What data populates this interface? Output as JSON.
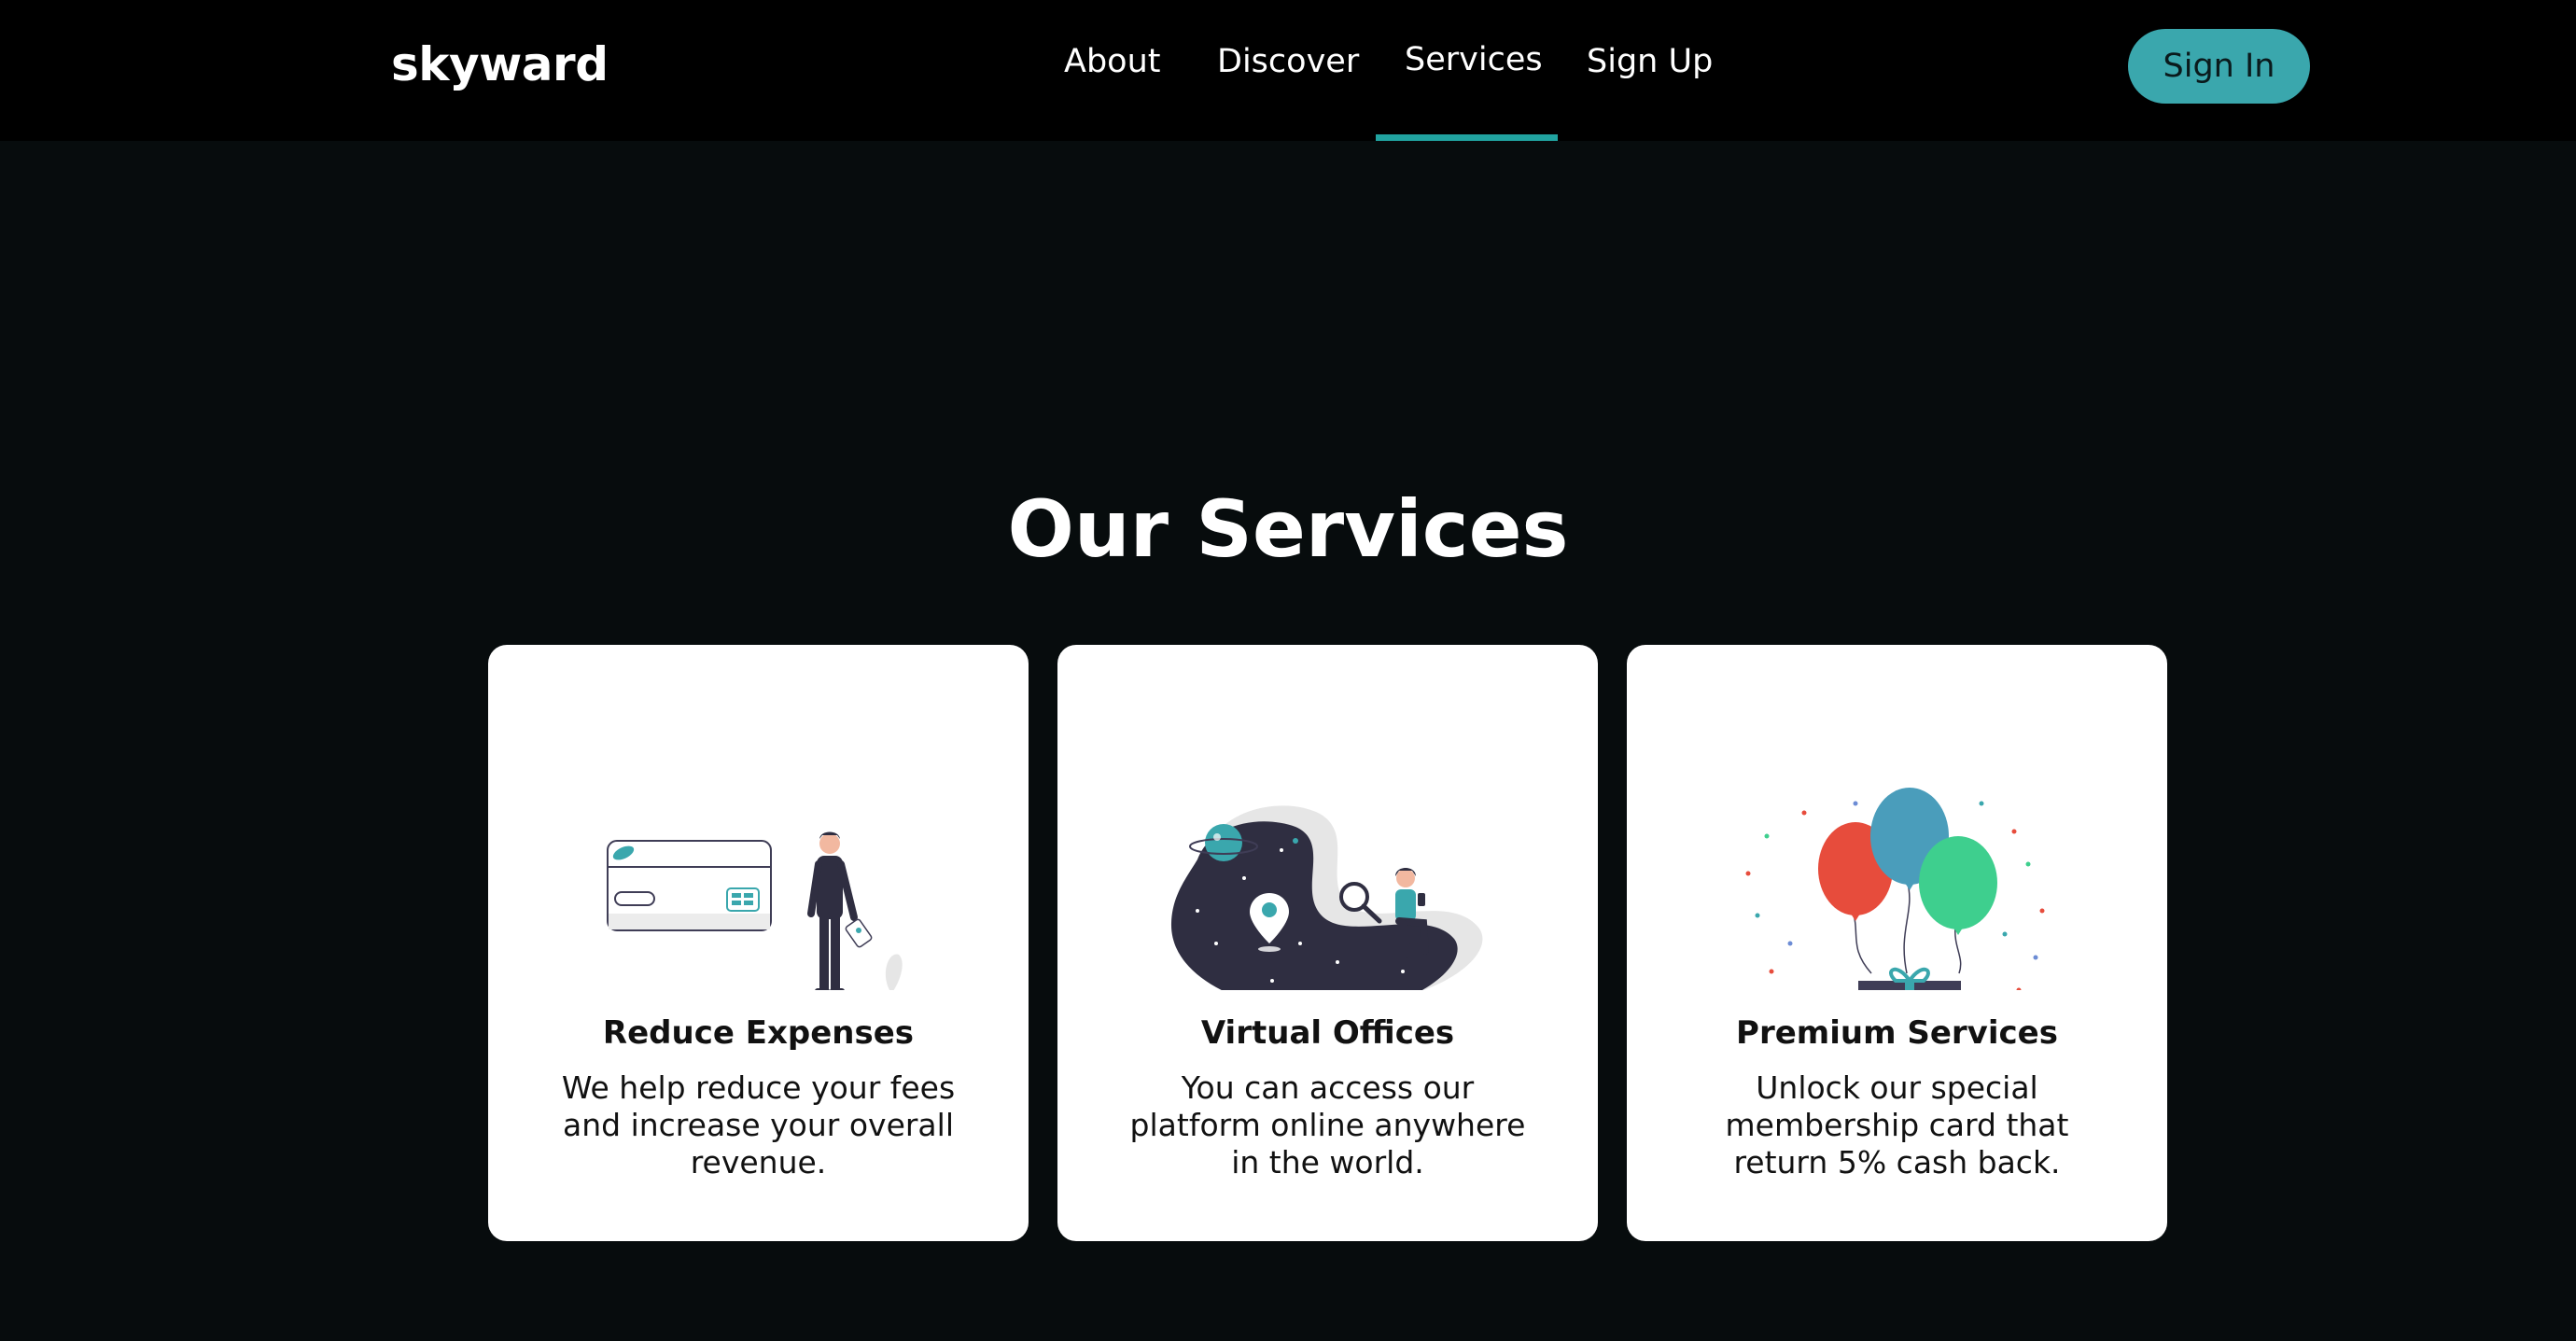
{
  "header": {
    "logo": "skyward",
    "nav": {
      "about": "About",
      "discover": "Discover",
      "services": "Services",
      "signup": "Sign Up"
    },
    "active_nav": "Services",
    "signin_label": "Sign In"
  },
  "main": {
    "title": "Our Services",
    "cards": [
      {
        "title": "Reduce Expenses",
        "description": "We help reduce your fees and increase your overall revenue.",
        "illustration": "credit-card-person-illustration"
      },
      {
        "title": "Virtual Offices",
        "description": "You can access our platform online anywhere in the world.",
        "illustration": "space-location-illustration"
      },
      {
        "title": "Premium Services",
        "description": "Unlock our special membership card that return 5% cash back.",
        "illustration": "balloons-gift-illustration"
      }
    ]
  },
  "colors": {
    "page_background": "#070c0d",
    "header_background": "#000000",
    "accent": "#21a3a0",
    "button": "#3aa7ad",
    "card": "#ffffff"
  }
}
